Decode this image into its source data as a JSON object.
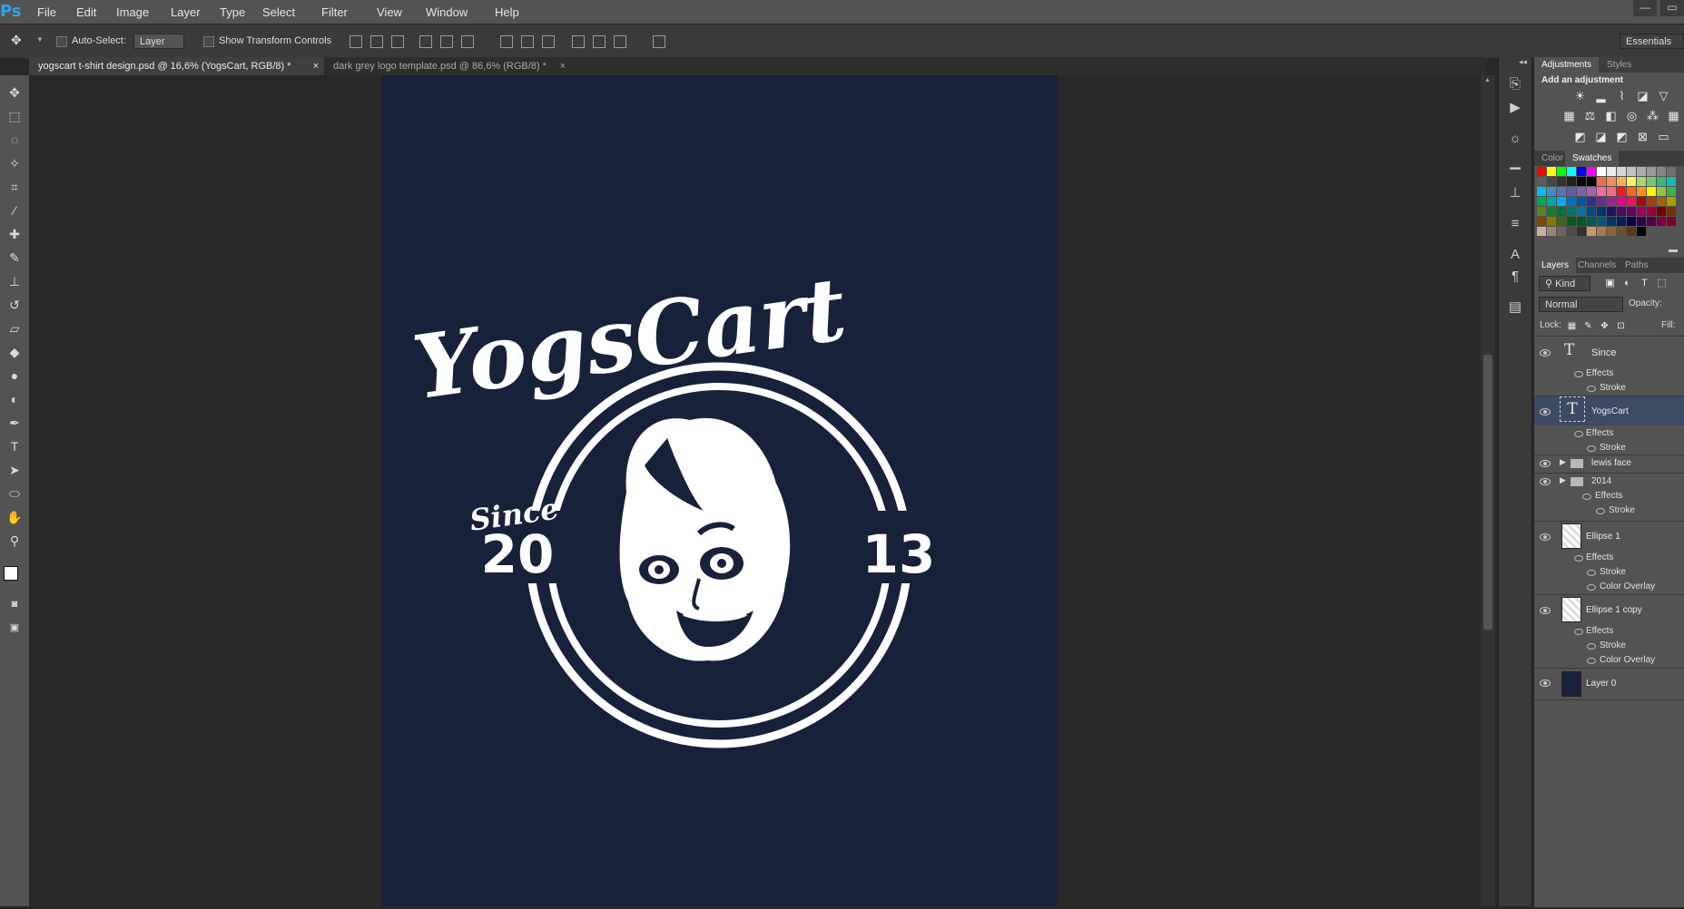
{
  "app": {
    "logo": "Ps"
  },
  "menu": [
    "File",
    "Edit",
    "Image",
    "Layer",
    "Type",
    "Select",
    "Filter",
    "View",
    "Window",
    "Help"
  ],
  "window_controls": [
    "—",
    "▭"
  ],
  "options": {
    "auto_select_label": "Auto-Select:",
    "auto_select_value": "Layer",
    "show_transform_label": "Show Transform Controls",
    "workspace": "Essentials"
  },
  "doc_tabs": [
    {
      "label": "yogscart t-shirt design.psd @ 16,6% (YogsCart, RGB/8) *",
      "close": "×"
    },
    {
      "label": "dark grey logo template.psd @ 86,6% (RGB/8) *",
      "close": "×"
    }
  ],
  "artwork": {
    "brand": "YogsCart",
    "since": "Since",
    "year_left": "20",
    "year_right": "13",
    "background": "#18213a",
    "ink": "#ffffff"
  },
  "panels": {
    "adjust_tabs": [
      "Adjustments",
      "Styles"
    ],
    "add_adjustment": "Add an adjustment",
    "adjust_icons_row1": [
      "brightness-icon",
      "levels-icon",
      "curves-icon",
      "exposure-icon",
      "vibrance-icon"
    ],
    "adjust_icons_row2": [
      "hue-sat-icon",
      "color-balance-icon",
      "bw-icon",
      "photo-filter-icon",
      "channel-mixer-icon",
      "color-lookup-icon"
    ],
    "adjust_icons_row3": [
      "invert-icon",
      "posterize-icon",
      "threshold-icon",
      "selective-color-icon",
      "gradient-map-icon"
    ],
    "color_tabs": [
      "Color",
      "Swatches"
    ],
    "layers_tabs": [
      "Layers",
      "Channels",
      "Paths"
    ],
    "kind_label": "Kind",
    "blend_mode": "Normal",
    "opacity_label": "Opacity:",
    "lock_label": "Lock:",
    "fill_label": "Fill:"
  },
  "swatch_colors": [
    [
      "#ff0000",
      "#ffff00",
      "#00ff00",
      "#00ffff",
      "#0000ff",
      "#ff00ff",
      "#ffffff",
      "#ebebeb",
      "#d6d6d6",
      "#c2c2c2",
      "#adadad",
      "#999999",
      "#858585",
      "#707070"
    ],
    [
      "#5c5c5c",
      "#474747",
      "#333333",
      "#1f1f1f",
      "#0a0a0a",
      "#000000",
      "#f26c4f",
      "#f68e55",
      "#fbaf5c",
      "#fff467",
      "#acd372",
      "#7cc576",
      "#3bb878",
      "#1abbb4"
    ],
    [
      "#00bff3",
      "#438ccb",
      "#5574b9",
      "#605ca8",
      "#855fa8",
      "#a763a8",
      "#f06ea9",
      "#f26d7d",
      "#ed1c24",
      "#f26522",
      "#f7941d",
      "#fff200",
      "#8dc63f",
      "#39b54a"
    ],
    [
      "#00a651",
      "#00a99d",
      "#00aeef",
      "#0072bc",
      "#0054a6",
      "#2e3192",
      "#662d91",
      "#92278f",
      "#ec008c",
      "#ed145b",
      "#9e0b0f",
      "#a0410d",
      "#a36209",
      "#aba000"
    ],
    [
      "#598527",
      "#1a7b30",
      "#007236",
      "#00746b",
      "#0076a3",
      "#004b80",
      "#003471",
      "#1b1464",
      "#440e62",
      "#630460",
      "#9e005d",
      "#9e0039",
      "#790000",
      "#7b2e00"
    ],
    [
      "#7d4900",
      "#827b00",
      "#406618",
      "#005e20",
      "#005826",
      "#005952",
      "#005b7f",
      "#003663",
      "#002157",
      "#0d004c",
      "#32004b",
      "#4b0049",
      "#7b0046",
      "#7a0026"
    ],
    [
      "#c7b299",
      "#998675",
      "#736357",
      "#534741",
      "#37302d",
      "#c69c6d",
      "#a67c52",
      "#8c6239",
      "#754c24",
      "#603913",
      "#000000"
    ]
  ],
  "layers": [
    {
      "name": "Since",
      "kind": "text",
      "effects_label": "Effects",
      "effects": [
        "Stroke"
      ]
    },
    {
      "name": "YogsCart",
      "kind": "text",
      "effects_label": "Effects",
      "effects": [
        "Stroke"
      ],
      "selected": true
    },
    {
      "name": "lewis face",
      "kind": "group"
    },
    {
      "name": "2014",
      "kind": "group",
      "effects_label": "Effects",
      "effects": [
        "Stroke"
      ]
    },
    {
      "name": "Ellipse 1",
      "kind": "shape",
      "effects_label": "Effects",
      "effects": [
        "Stroke",
        "Color Overlay"
      ]
    },
    {
      "name": "Ellipse 1 copy",
      "kind": "shape",
      "effects_label": "Effects",
      "effects": [
        "Stroke",
        "Color Overlay"
      ]
    },
    {
      "name": "Layer 0",
      "kind": "fill"
    }
  ]
}
